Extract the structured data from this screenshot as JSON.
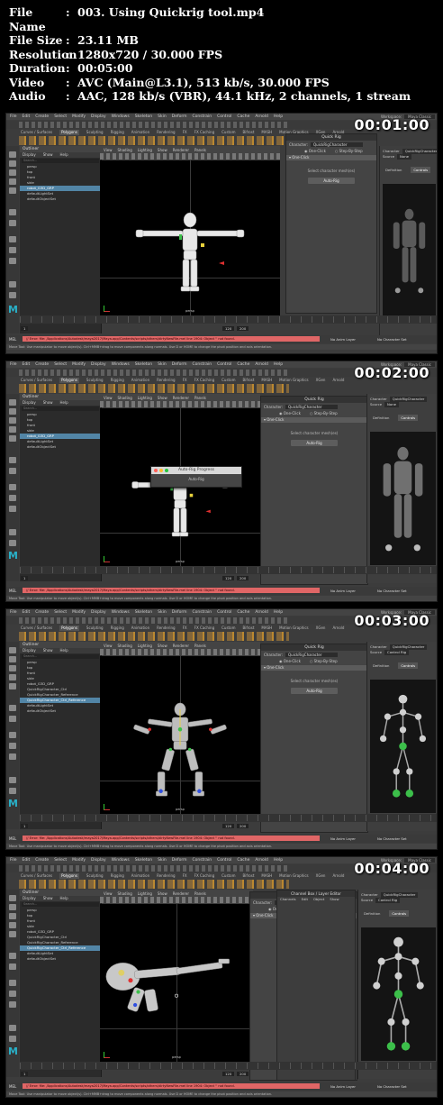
{
  "file_info": {
    "rows": [
      {
        "key": "File Name",
        "value": "003. Using Quickrig tool.mp4"
      },
      {
        "key": "File Size",
        "value": "23.11 MB"
      },
      {
        "key": "Resolution",
        "value": "1280x720 / 30.000 FPS"
      },
      {
        "key": "Duration",
        "value": "00:05:00"
      },
      {
        "key": "Video",
        "value": "AVC (Main@L3.1), 513 kb/s, 30.000 FPS"
      },
      {
        "key": "Audio",
        "value": "AAC, 128 kb/s (VBR), 44.1 kHz, 2 channels, 1 stream"
      }
    ]
  },
  "maya": {
    "menus": [
      "File",
      "Edit",
      "Create",
      "Select",
      "Modify",
      "Display",
      "Windows",
      "Skeleton",
      "Skin",
      "Deform",
      "Constrain",
      "Control",
      "Cache",
      "Arnold",
      "Help"
    ],
    "mode_menu": "Rigging",
    "workspace_label": "Workspace:",
    "workspace_value": "Maya Classic",
    "live_surface": "No Live Surface",
    "shelf_tabs": [
      "Curves / Surfaces",
      "Polygons",
      "Sculpting",
      "Rigging",
      "Animation",
      "Rendering",
      "FX",
      "FX Caching",
      "Custom",
      "Bifrost",
      "MASH",
      "Motion Graphics",
      "XGen",
      "Arnold"
    ],
    "shelf_active": "Polygons",
    "outliner_title": "Outliner",
    "outliner_menu": [
      "Display",
      "Show",
      "Help"
    ],
    "search_placeholder": "Search...",
    "viewport_menu": [
      "View",
      "Shading",
      "Lighting",
      "Show",
      "Renderer",
      "Panels"
    ],
    "quickrig_title": "Quick Rig",
    "character_label": "Character:",
    "character_name": "QuickRigCharacter",
    "one_click": "One-Click",
    "step_by_step": "Step-By-Step",
    "one_click_section": "One-Click",
    "hint": "Select character mesh(es)",
    "autorig_button": "Auto-Rig",
    "hik_character_label": "Character",
    "hik_source_label": "Source",
    "hik_source_value": "None",
    "hik_control_rig": "Control Rig",
    "hik_tabs": [
      "Definition",
      "Controls"
    ],
    "hik_footer": "Humanik Controls",
    "no_anim_layer": "No Anim Layer",
    "no_character_set": "No Character Set",
    "mel_label": "MEL",
    "error_text": "// Error: file: /Applications/Autodesk/maya2017/Maya.app/Contents/scripts/others/dirtyNewFile.mel line 1904: Object '' not found.",
    "help_text": "Move Tool: Use manipulator to move object(s). Ctrl+MMB+drag to move components along normals. Use D or HOME to change the pivot position and axis orientation.",
    "frame_start": "1",
    "frame_end": "120",
    "frame_end_range": "200",
    "persp": "persp",
    "progress_title": "Auto-Rig Progress",
    "progress_label": "Auto-Rig",
    "channel_box_title": "Channel Box / Layer Editor",
    "channel_menu": [
      "Channels",
      "Edit",
      "Object",
      "Show"
    ],
    "humanik_title": "HumanIK"
  },
  "frames": [
    {
      "timestamp": "00:01:00",
      "outliner_items": [
        "persp",
        "top",
        "front",
        "side",
        "robot_G3D_GRP",
        "defaultLightSet",
        "defaultObjectSet"
      ],
      "selected": 4
    },
    {
      "timestamp": "00:02:00",
      "outliner_items": [
        "persp",
        "top",
        "front",
        "side",
        "robot_G3D_GRP",
        "defaultLightSet",
        "defaultObjectSet"
      ],
      "selected": 4
    },
    {
      "timestamp": "00:03:00",
      "outliner_items": [
        "persp",
        "top",
        "front",
        "side",
        "robot_G3D_GRP",
        "QuickRigCharacter_Ctrl",
        "QuickRigCharacter_Reference",
        "QuickRigCharacter_Ctrl_Reference",
        "defaultLightSet",
        "defaultObjectSet"
      ],
      "selected": 7
    },
    {
      "timestamp": "00:04:00",
      "outliner_items": [
        "persp",
        "top",
        "front",
        "side",
        "robot_G3D_GRP",
        "QuickRigCharacter_Ctrl",
        "QuickRigCharacter_Reference",
        "QuickRigCharacter_Ctrl_Reference",
        "defaultLightSet",
        "defaultObjectSet"
      ],
      "selected": 7
    }
  ],
  "colors": {
    "accent": "#5285a6",
    "error": "#e06666",
    "maya_logo": "#29b0c8",
    "shelf_orange": "#c89030"
  }
}
